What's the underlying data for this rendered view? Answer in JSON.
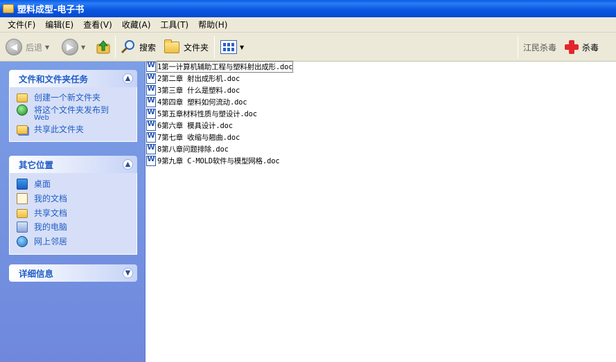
{
  "window": {
    "title": "塑料成型-电子书"
  },
  "menu": [
    {
      "label": "文件(F)"
    },
    {
      "label": "编辑(E)"
    },
    {
      "label": "查看(V)"
    },
    {
      "label": "收藏(A)"
    },
    {
      "label": "工具(T)"
    },
    {
      "label": "帮助(H)"
    }
  ],
  "toolbar": {
    "back_label": "后退",
    "search_label": "搜索",
    "folders_label": "文件夹",
    "antivirus_brand": "江民杀毒",
    "antivirus_button": "杀毒"
  },
  "sidebar": {
    "tasks": {
      "title": "文件和文件夹任务",
      "items": [
        {
          "label": "创建一个新文件夹",
          "icon": "new-folder-icon"
        },
        {
          "label": "将这个文件夹发布到",
          "sub": "Web",
          "icon": "publish-web-icon"
        },
        {
          "label": "共享此文件夹",
          "icon": "share-folder-icon"
        }
      ]
    },
    "places": {
      "title": "其它位置",
      "items": [
        {
          "label": "桌面",
          "icon": "desktop-icon"
        },
        {
          "label": "我的文档",
          "icon": "my-documents-icon"
        },
        {
          "label": "共享文档",
          "icon": "shared-documents-icon"
        },
        {
          "label": "我的电脑",
          "icon": "my-computer-icon"
        },
        {
          "label": "网上邻居",
          "icon": "network-places-icon"
        }
      ]
    },
    "details": {
      "title": "详细信息"
    }
  },
  "files": [
    {
      "name": "1第一计算机辅助工程与塑料射出成形.doc",
      "selected": true
    },
    {
      "name": "2第二章  射出成形机.doc"
    },
    {
      "name": "3第三章  什么是塑料.doc"
    },
    {
      "name": "4第四章  塑料如何流动.doc"
    },
    {
      "name": "5第五章材料性质与塑设计.doc"
    },
    {
      "name": "6第六章 模具设计.doc"
    },
    {
      "name": "7第七章 收缩与翘曲.doc"
    },
    {
      "name": "8第八章问题排除.doc"
    },
    {
      "name": "9第九章  C-MOLD软件与模型网格.doc"
    }
  ]
}
